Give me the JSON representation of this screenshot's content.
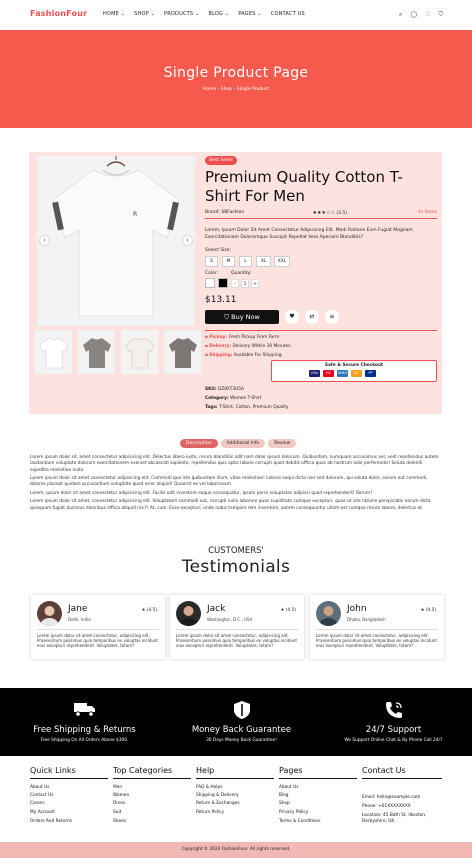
{
  "header": {
    "logo": "FashionFour",
    "nav": [
      "HOME",
      "SHOP",
      "PRODUCTS",
      "BLOG",
      "PAGES",
      "CONTACT US"
    ],
    "nav_dropdown": [
      true,
      true,
      true,
      true,
      true,
      false
    ]
  },
  "banner": {
    "title": "Single Product Page",
    "breadcrumb": [
      "Home",
      "Shop",
      "Single Product"
    ]
  },
  "product": {
    "badge": "Best Seller",
    "title": "Premium Quality Cotton T-Shirt For Men",
    "brand_label": "Brand:",
    "brand": "SBFashion",
    "rating": "(3.5)",
    "stock": "In Stock",
    "description": "Lorem, Ipsum Dolor Sit Amet Consectetur Adipisicing Elit. Modi Ratione Eum Fugiat Magnam Exercitationem Doloremque Suscipit Repellat Vero Aperiam Blanditiis?",
    "size_label": "Select Size:",
    "sizes": [
      "S",
      "M",
      "L",
      "XL",
      "XXL"
    ],
    "color_label": "Color:",
    "colors": [
      "#ffffff",
      "#000000"
    ],
    "quantity_label": "Quantity:",
    "quantity": "1",
    "qty_minus": "-",
    "qty_plus": "+",
    "price": "$13.11",
    "buy_now": "Buy Now",
    "shipping": [
      {
        "label": "Pickup:",
        "text": "Fresh Pickup From Farm."
      },
      {
        "label": "Delivery:",
        "text": "Delivery Within 30 Minutes."
      },
      {
        "label": "Shipping:",
        "text": "Available For Shipping."
      }
    ],
    "checkout_title": "Safe & Secure Checkout",
    "payments": [
      "VISA",
      "MC",
      "AMEX",
      "MC",
      "PP"
    ],
    "sku_label": "SKU:",
    "sku": "DZ8XT3U5A",
    "category_label": "Category:",
    "category": "Women T-Shirt",
    "tags_label": "Tags:",
    "tags": "T-Shirt, Cotton, Premium Quality"
  },
  "tabs": [
    "Description",
    "Additional Info",
    "Review"
  ],
  "long_description": [
    "Lorem ipsum dolor sit, amet consectetur adipisicing elit. Delectus libero iusto, rerum blanditiis odit nam dolor ipsum dolorum. Quibusdam, numquam accusamus vel, velit repellendus autem laudantium voluptate dolorum exercitationem eveniet obcaecati sapiente, repellendus quis optio labore corrupti quod debitis officia quos ab nostrum odio perferendis! Soluta deleniti expedita molestiae nulla.",
    "Lorem ipsum dolor sit amet consectetur adipisicing elit. Commodi quo iste quibusdam illum, vitae molestiae! Labore sequi dicta non sed dolorum, qui soluta dolor, earum aut commodi, dolores placeat quidem accusantium voluptate quod error aliquid! Quaerat ex vel laboriosam.",
    "Lorem, ipsum dolor sit amet consectetur adipisicing elit. Facilis odit inventore eaque consequatur, ipsam porro voluptates adipisci quod reprehenderit! Rerum?",
    "Lorem ipsum dolor sit amet, consectetur adipisicing elit. Voluptatem commodi aut, corrupti nulla laborum quas cupiditate cumque excepturi, quae ut iste ratione perspiciatis earum dicta quisquam fugiat ducimus doloribus officia aliquid nisi?! At, cum. Esse excepturi, unde nobis tempore rem inventore, autem consequuntur ullam est cumque rerum labore, delectus et."
  ],
  "testimonials": {
    "subtitle": "CUSTOMERS'",
    "title": "Testimonials",
    "items": [
      {
        "name": "Jane",
        "location": "Delhi, India",
        "rating": "(4.5)",
        "text": "Lorem ipsum dolor sit amet consectetur, adipisicing elit. Praesentium possimus quia temporibus ex voluptas incidunt eius excepturi reprehenderit. Voluptates, totam?"
      },
      {
        "name": "Jack",
        "location": "Washington, D.C., USA",
        "rating": "(4.5)",
        "text": "Lorem ipsum dolor sit amet consectetur, adipisicing elit. Praesentium possimus quia temporibus ex voluptas incidunt eius excepturi reprehenderit. Voluptates, totam?"
      },
      {
        "name": "John",
        "location": "Dhaka, Bangladesh",
        "rating": "(4.5)",
        "text": "Lorem ipsum dolor sit amet consectetur, adipisicing elit. Praesentium possimus quia temporibus ex voluptas incidunt eius excepturi reprehenderit. Voluptates, totam?"
      }
    ]
  },
  "features": [
    {
      "icon": "truck-icon",
      "title": "Free Shipping & Returns",
      "sub": "Free Shipping On All Orders Above $300."
    },
    {
      "icon": "shield-icon",
      "title": "Money Back Guarantee",
      "sub": "30 Days Money Back Guarantee!"
    },
    {
      "icon": "phone-icon",
      "title": "24/7 Support",
      "sub": "We Support Online Chat & By Phone Call 24/7"
    }
  ],
  "footer": {
    "quick_links": {
      "title": "Quick Links",
      "items": [
        "About Us",
        "Contact Us",
        "Career",
        "My Account",
        "Orders And Returns"
      ]
    },
    "top_categories": {
      "title": "Top Categories",
      "items": [
        "Men",
        "Women",
        "Dress",
        "Suit",
        "Shoes"
      ]
    },
    "help": {
      "title": "Help",
      "items": [
        "FAQ & Helps",
        "Shipping & Delivery",
        "Return & Exchanges",
        "Return Policy"
      ]
    },
    "pages": {
      "title": "Pages",
      "items": [
        "About Us",
        "Blog",
        "Shop",
        "Privacy Policy",
        "Terms & Conditions"
      ]
    },
    "contact": {
      "title": "Contact Us",
      "email": "Email: hello@example.com",
      "phone": "Phone: +01XXXXXXXX",
      "location": "Location: 45 Bath St, Ilkeston, Derbyshire, UK"
    },
    "copyright": "Copyright © 2024 FashionFour. All rights reserved."
  },
  "colors": {
    "accent": "#ef4e4e",
    "banner": "#f65a4c",
    "product_bg": "#fde3e0",
    "footer_bar": "#f2b8b3"
  }
}
